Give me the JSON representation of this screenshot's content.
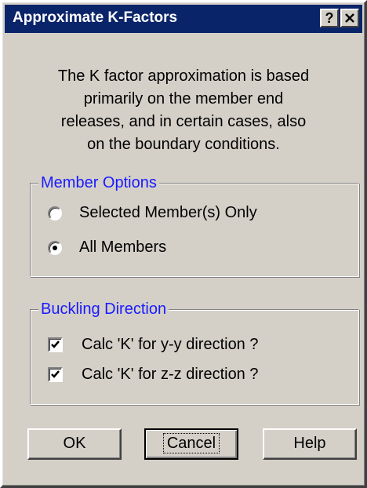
{
  "window": {
    "title": "Approximate K-Factors",
    "help_button": "?",
    "close_button": "✕"
  },
  "description": {
    "lines": [
      "The K factor approximation is based",
      "primarily on the member end",
      "releases, and in certain cases, also",
      "on the boundary conditions."
    ]
  },
  "member_options": {
    "legend": "Member Options",
    "options": [
      {
        "label": "Selected Member(s) Only",
        "selected": false
      },
      {
        "label": "All Members",
        "selected": true
      }
    ]
  },
  "buckling_direction": {
    "legend": "Buckling Direction",
    "checks": [
      {
        "label": "Calc 'K' for y-y direction ?",
        "checked": true
      },
      {
        "label": "Calc 'K' for z-z direction ?",
        "checked": true
      }
    ]
  },
  "buttons": {
    "ok": "OK",
    "cancel": "Cancel",
    "help": "Help"
  }
}
